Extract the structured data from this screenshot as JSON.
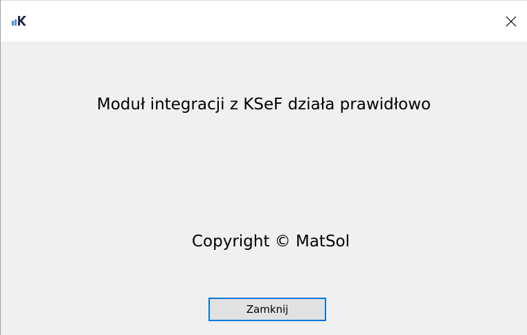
{
  "window": {
    "icon": "ksef-app-icon",
    "close_icon": "close-icon"
  },
  "content": {
    "message": "Moduł integracji z KSeF działa prawidłowo",
    "copyright": "Copyright © MatSol"
  },
  "buttons": {
    "close_label": "Zamknij"
  },
  "colors": {
    "window_bg": "#f0f0f0",
    "titlebar_bg": "#ffffff",
    "button_border": "#0078d7",
    "button_bg": "#e1e1e1",
    "icon_blue": "#4a90d9",
    "icon_dark": "#1f2a44"
  }
}
